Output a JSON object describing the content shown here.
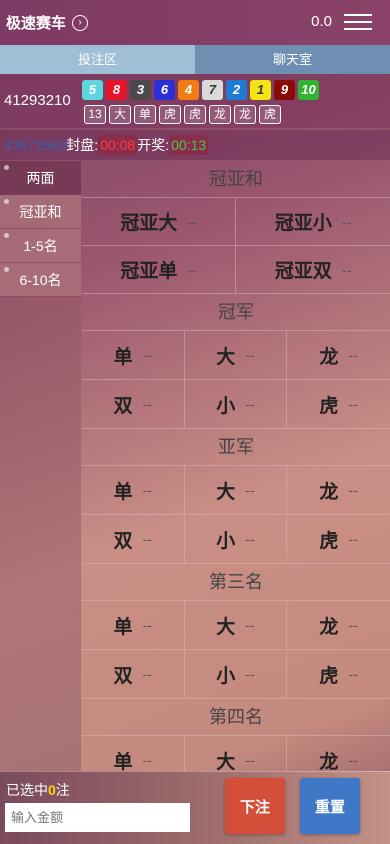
{
  "header": {
    "title": "极速赛车",
    "balance": "0.0"
  },
  "tabs": [
    {
      "label": "投注区"
    },
    {
      "label": "聊天室"
    }
  ],
  "draw": {
    "issue": "41293210",
    "balls": [
      {
        "num": "5",
        "color": "#5fd5e0"
      },
      {
        "num": "8",
        "color": "#e8142a"
      },
      {
        "num": "3",
        "color": "#4a4a4a"
      },
      {
        "num": "6",
        "color": "#2b2fd6"
      },
      {
        "num": "4",
        "color": "#f27c14"
      },
      {
        "num": "7",
        "color": "#d9d9d9"
      },
      {
        "num": "2",
        "color": "#1f7bd6"
      },
      {
        "num": "1",
        "color": "#f3e515"
      },
      {
        "num": "9",
        "color": "#8a0a0a"
      },
      {
        "num": "10",
        "color": "#2fb52f"
      }
    ],
    "tags": [
      "13",
      "大",
      "单",
      "虎",
      "虎",
      "龙",
      "龙",
      "虎"
    ]
  },
  "timer": {
    "next_issue": "43672689",
    "close_label": "封盘:",
    "close_time": "00:08",
    "open_label": "开奖:",
    "open_time": "00:13"
  },
  "nav": [
    {
      "label": "两面"
    },
    {
      "label": "冠亚和"
    },
    {
      "label": "1-5名"
    },
    {
      "label": "6-10名"
    }
  ],
  "sections": {
    "guanyahe": {
      "title": "冠亚和",
      "items": [
        {
          "name": "冠亚大",
          "odds": "--"
        },
        {
          "name": "冠亚小",
          "odds": "--"
        },
        {
          "name": "冠亚单",
          "odds": "--"
        },
        {
          "name": "冠亚双",
          "odds": "--"
        }
      ]
    },
    "ranks": [
      {
        "title": "冠军",
        "items": [
          {
            "name": "单",
            "odds": "--"
          },
          {
            "name": "大",
            "odds": "--"
          },
          {
            "name": "龙",
            "odds": "--"
          },
          {
            "name": "双",
            "odds": "--"
          },
          {
            "name": "小",
            "odds": "--"
          },
          {
            "name": "虎",
            "odds": "--"
          }
        ]
      },
      {
        "title": "亚军",
        "items": [
          {
            "name": "单",
            "odds": "--"
          },
          {
            "name": "大",
            "odds": "--"
          },
          {
            "name": "龙",
            "odds": "--"
          },
          {
            "name": "双",
            "odds": "--"
          },
          {
            "name": "小",
            "odds": "--"
          },
          {
            "name": "虎",
            "odds": "--"
          }
        ]
      },
      {
        "title": "第三名",
        "items": [
          {
            "name": "单",
            "odds": "--"
          },
          {
            "name": "大",
            "odds": "--"
          },
          {
            "name": "龙",
            "odds": "--"
          },
          {
            "name": "双",
            "odds": "--"
          },
          {
            "name": "小",
            "odds": "--"
          },
          {
            "name": "虎",
            "odds": "--"
          }
        ]
      },
      {
        "title": "第四名",
        "items": [
          {
            "name": "单",
            "odds": "--"
          },
          {
            "name": "大",
            "odds": "--"
          },
          {
            "name": "龙",
            "odds": "--"
          }
        ]
      }
    ]
  },
  "bottom": {
    "selected_prefix": "已选中",
    "selected_count": "0",
    "selected_suffix": "注",
    "amount_placeholder": "输入金额",
    "bet_label": "下注",
    "reset_label": "重置"
  }
}
